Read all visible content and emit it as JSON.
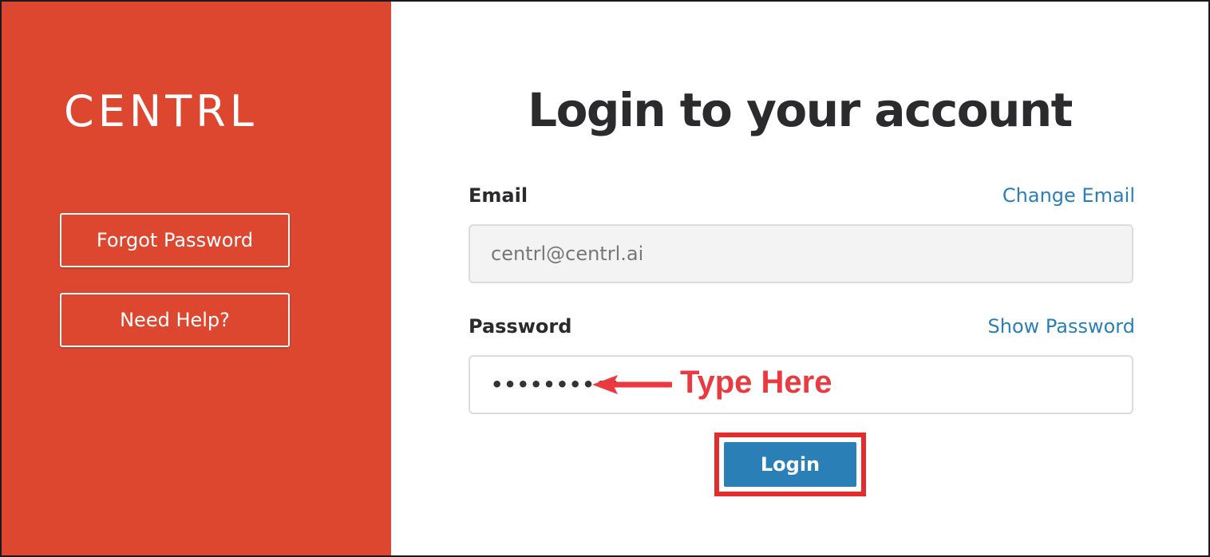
{
  "brand": {
    "logo_text": "CENTRL",
    "panel_color": "#dd4730"
  },
  "sidebar": {
    "forgot_password_label": "Forgot Password",
    "need_help_label": "Need Help?"
  },
  "login_form": {
    "title": "Login to your account",
    "email": {
      "label": "Email",
      "change_link": "Change Email",
      "value": "centrl@centrl.ai"
    },
    "password": {
      "label": "Password",
      "show_link": "Show Password",
      "masked_value": "••••••••••"
    },
    "submit_label": "Login",
    "accent_color": "#2a7fb7"
  },
  "annotation": {
    "text": "Type Here",
    "arrow_icon": "arrow-left-icon",
    "color": "#ea3a3f"
  }
}
